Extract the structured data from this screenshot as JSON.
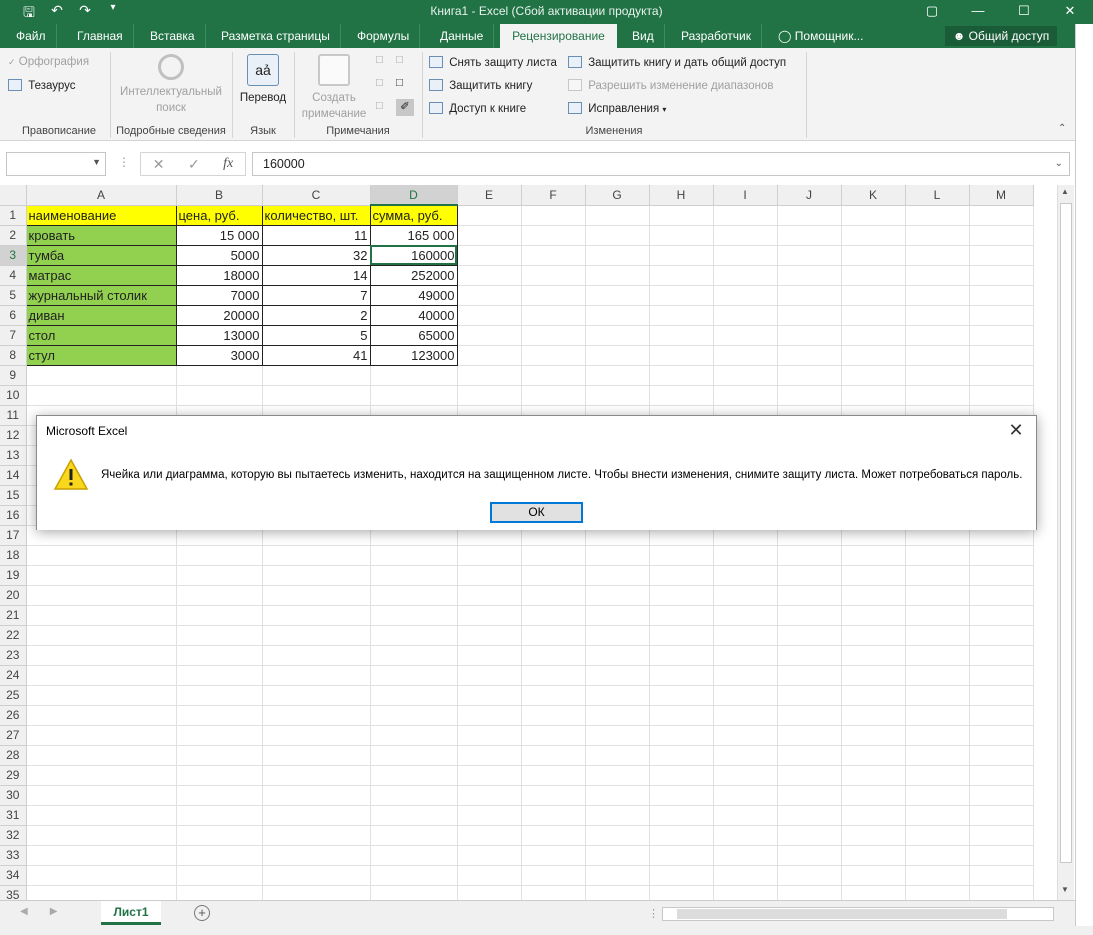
{
  "window": {
    "title": "Книга1 - Excel (Сбой активации продукта)",
    "controls": [
      "restore-icon",
      "minimize-icon",
      "maximize-icon",
      "close-icon"
    ]
  },
  "ribbon_tabs": [
    {
      "label": "Файл"
    },
    {
      "label": "Главная"
    },
    {
      "label": "Вставка"
    },
    {
      "label": "Разметка страницы"
    },
    {
      "label": "Формулы"
    },
    {
      "label": "Данные"
    },
    {
      "label": "Рецензирование",
      "active": true
    },
    {
      "label": "Вид"
    },
    {
      "label": "Разработчик"
    },
    {
      "label": "Помощник..."
    }
  ],
  "share_button": "Общий доступ",
  "ribbon": {
    "spelling": "Орфография",
    "thesaurus": "Тезаурус",
    "grp_proofing": "Правописание",
    "smart_lookup_1": "Интеллектуальный",
    "smart_lookup_2": "поиск",
    "grp_insights": "Подробные сведения",
    "translate": "Перевод",
    "grp_language": "Язык",
    "new_comment_1": "Создать",
    "new_comment_2": "примечание",
    "grp_comments": "Примечания",
    "unprotect_sheet": "Снять защиту листа",
    "protect_workbook": "Защитить книгу",
    "share_workbook_access": "Доступ к книге",
    "protect_share": "Защитить книгу и дать общий доступ",
    "allow_ranges": "Разрешить изменение диапазонов",
    "track_changes": "Исправления",
    "grp_changes": "Изменения"
  },
  "formula_bar": {
    "name_box": "",
    "value": "160000",
    "fx": "fx"
  },
  "columns": [
    "A",
    "B",
    "C",
    "D",
    "E",
    "F",
    "G",
    "H",
    "I",
    "J",
    "K",
    "L",
    "M"
  ],
  "selected_column": "D",
  "selected_row": 3,
  "rows": [
    [
      "наименование",
      "цена, руб.",
      "количество, шт.",
      "сумма, руб."
    ],
    [
      "кровать",
      "15 000",
      "11",
      "165 000"
    ],
    [
      "тумба",
      "5000",
      "32",
      "160000"
    ],
    [
      "матрас",
      "18000",
      "14",
      "252000"
    ],
    [
      "журнальный столик",
      "7000",
      "7",
      "49000"
    ],
    [
      "диван",
      "20000",
      "2",
      "40000"
    ],
    [
      "стол",
      "13000",
      "5",
      "65000"
    ],
    [
      "стул",
      "3000",
      "41",
      "123000"
    ]
  ],
  "row_numbers": [
    "1",
    "2",
    "3",
    "4",
    "5",
    "6",
    "7",
    "8",
    "9",
    "10",
    "11",
    "12",
    "13",
    "14",
    "15",
    "16",
    "17",
    "18",
    "19",
    "20",
    "21",
    "22",
    "23",
    "24",
    "25",
    "26",
    "27",
    "28",
    "29",
    "30",
    "31",
    "32",
    "33",
    "34",
    "35"
  ],
  "sheet_tab": "Лист1",
  "dialog": {
    "title": "Microsoft Excel",
    "message": "Ячейка или диаграмма, которую вы пытаетесь изменить, находится на защищенном листе. Чтобы внести изменения, снимите защиту листа. Может потребоваться пароль.",
    "ok_label": "ОК"
  },
  "colors": {
    "excel_green": "#217346",
    "header_yellow": "#ffff00",
    "name_green": "#92d050"
  }
}
